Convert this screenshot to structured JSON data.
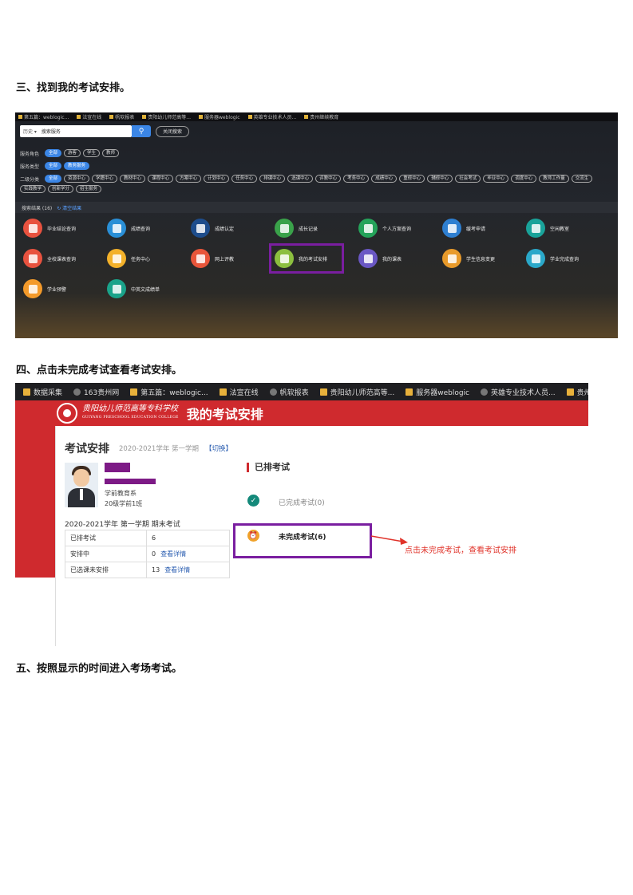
{
  "headings": {
    "step3": "三、找到我的考试安排。",
    "step4": "四、点击未完成考试查看考试安排。",
    "step5": "五、按照显示的时间进入考场考试。"
  },
  "shot1": {
    "bookmarks": [
      "第五篇：weblogic...",
      "法宣在线",
      "帆软报表",
      "贵阳幼儿师范高等...",
      "服务器weblogic",
      "英雄专业技术人员...",
      "贵州继续教育"
    ],
    "search": {
      "scope": "历史 ▾",
      "value": "搜索服务",
      "close": "关闭搜索"
    },
    "filters": {
      "role_label": "服务角色",
      "roles": [
        "全部",
        "游客",
        "学生",
        "教师"
      ],
      "type_label": "服务类型",
      "types": [
        "全部",
        "教务服务"
      ],
      "sub_label": "二级分类",
      "subs": [
        "全部",
        "资源中心",
        "学籍中心",
        "教材中心",
        "课程中心",
        "方案中心",
        "计划中心",
        "任务中心",
        "排课中心",
        "选课中心",
        "评教中心",
        "考务中心",
        "成绩中心",
        "重修中心",
        "辅修中心",
        "社会考试",
        "毕业中心",
        "调度中心",
        "教师工作量",
        "交流生",
        "实践教学",
        "创新学分",
        "招生服务"
      ]
    },
    "result_count": "搜索结果 (16)",
    "clear": "清空结果",
    "tiles": [
      "毕业结论查询",
      "成绩查询",
      "成绩认定",
      "成长记录",
      "个人方案查询",
      "缓考申请",
      "空闲教室",
      "全校课表查询",
      "任务中心",
      "网上评教",
      "我的考试安排",
      "我的课表",
      "学生信息变更",
      "学业完成查询",
      "学业预警",
      "中英文成绩单"
    ],
    "tile_colors": [
      "#e8523f",
      "#2a8fd6",
      "#1e4d8c",
      "#3aa24a",
      "#25a35a",
      "#2e7fd1",
      "#19a39a",
      "#e8523f",
      "#f3b12a",
      "#e8553a",
      "#8cbf3f",
      "#6a57c4",
      "#e89a2a",
      "#2aa8c9",
      "#f39a2a",
      "#1aa38a"
    ]
  },
  "shot2": {
    "bookmarks": [
      "数据采集",
      "163贵州网",
      "第五篇：weblogic...",
      "法宣在线",
      "帆软报表",
      "贵阳幼儿师范高等...",
      "服务器weblogic",
      "英雄专业技术人员...",
      "贵州继续教"
    ],
    "school_cn": "贵阳幼儿师范高等专科学校",
    "school_en": "GUIYANG PRESCHOOL EDUCATION COLLEGE",
    "app_title": "我的考试安排",
    "page_title": "考试安排",
    "term": "2020-2021学年 第一学期",
    "switch": "【切换】",
    "dept": "学前教育系",
    "class": "20级学前1班",
    "exam_term": "2020-2021学年 第一学期 期末考试",
    "stats": [
      {
        "label": "已排考试",
        "value": "6",
        "link": ""
      },
      {
        "label": "安排中",
        "value": "0",
        "link": "查看详情"
      },
      {
        "label": "已选课未安排",
        "value": "13",
        "link": "查看详情"
      }
    ],
    "scheduled": "已排考试",
    "done": "已完成考试(0)",
    "undone": "未完成考试(6)",
    "hint": "点击未完成考试，查看考试安排",
    "colors": {
      "header_red": "#cf2a2e",
      "highlight_purple": "#7a1ea0",
      "hint_red": "#e0332a"
    }
  }
}
